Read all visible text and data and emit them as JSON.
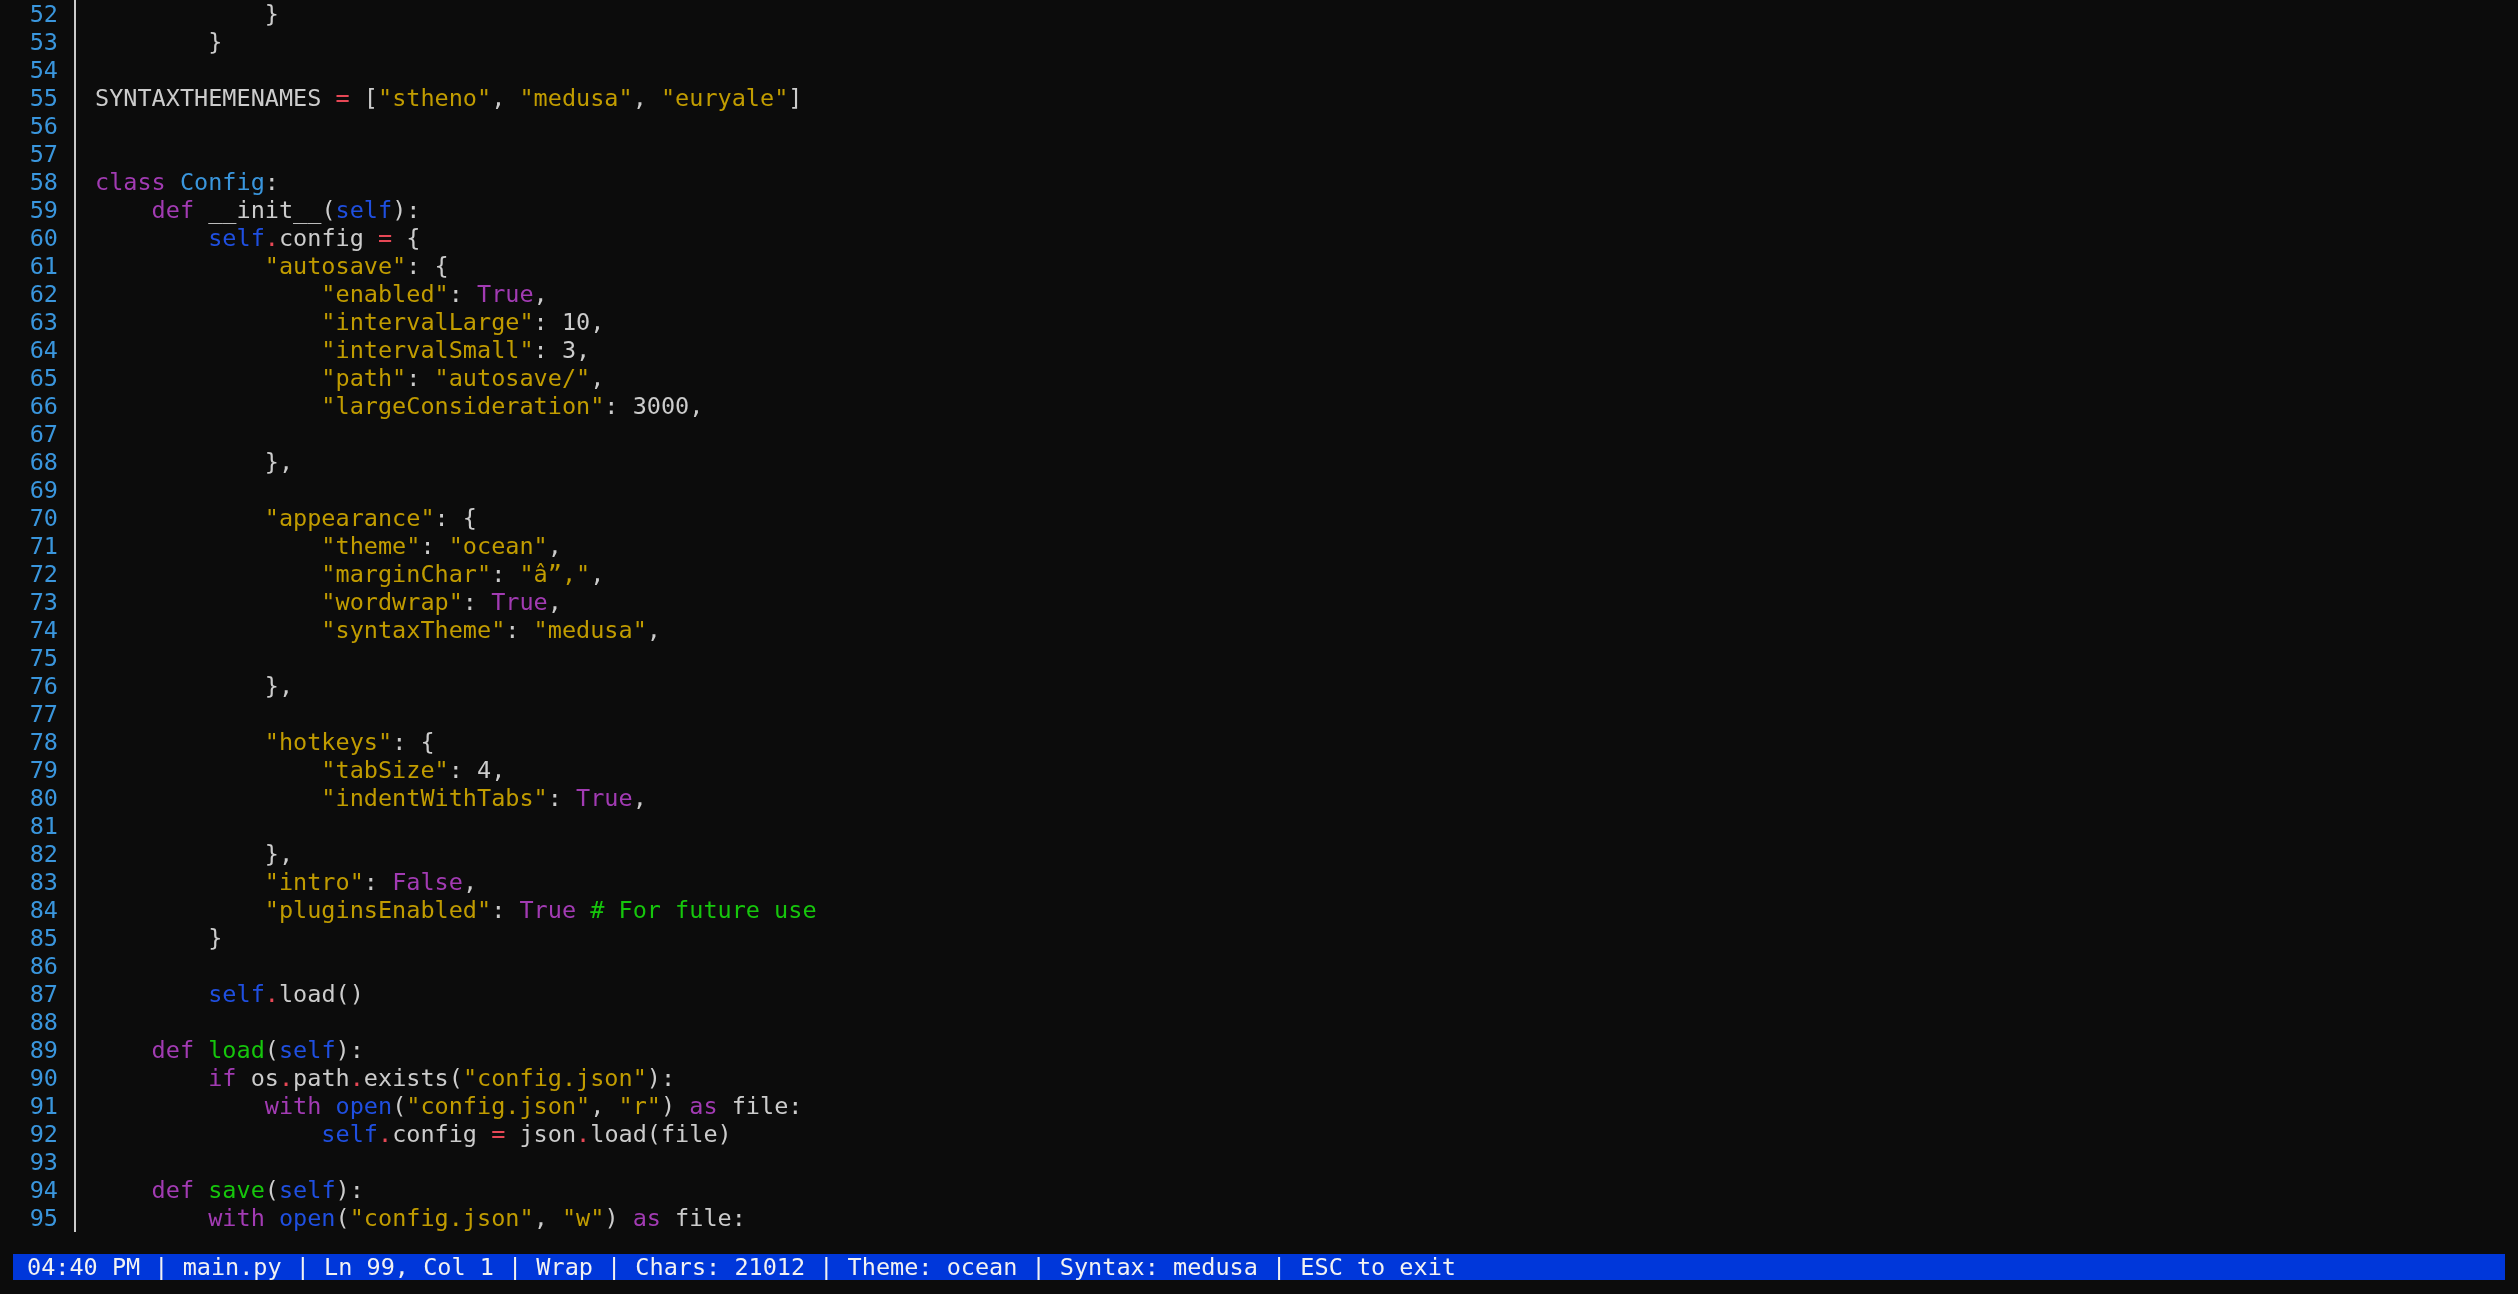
{
  "editor": {
    "lines": [
      {
        "number": "52",
        "tokens": [
          {
            "kind": "plain",
            "text": "            }"
          }
        ]
      },
      {
        "number": "53",
        "tokens": [
          {
            "kind": "plain",
            "text": "        }"
          }
        ]
      },
      {
        "number": "54"
      },
      {
        "number": "55",
        "tokens": [
          {
            "kind": "plain",
            "text": "SYNTAXTHEMENAMES "
          },
          {
            "kind": "operator",
            "text": "="
          },
          {
            "kind": "plain",
            "text": " ["
          },
          {
            "kind": "string",
            "text": "\"stheno\""
          },
          {
            "kind": "plain",
            "text": ", "
          },
          {
            "kind": "string",
            "text": "\"medusa\""
          },
          {
            "kind": "plain",
            "text": ", "
          },
          {
            "kind": "string",
            "text": "\"euryale\""
          },
          {
            "kind": "plain",
            "text": "]"
          }
        ]
      },
      {
        "number": "56"
      },
      {
        "number": "57"
      },
      {
        "number": "58",
        "tokens": [
          {
            "kind": "keyword",
            "text": "class"
          },
          {
            "kind": "classname",
            "text": " Config"
          },
          {
            "kind": "plain",
            "text": ":"
          }
        ]
      },
      {
        "number": "59",
        "tokens": [
          {
            "kind": "keyword",
            "text": "    def"
          },
          {
            "kind": "plain",
            "text": " __init__("
          },
          {
            "kind": "builtin",
            "text": "self"
          },
          {
            "kind": "plain",
            "text": "):"
          }
        ]
      },
      {
        "number": "60",
        "tokens": [
          {
            "kind": "builtin",
            "text": "        self"
          },
          {
            "kind": "operator",
            "text": "."
          },
          {
            "kind": "plain",
            "text": "config "
          },
          {
            "kind": "operator",
            "text": "="
          },
          {
            "kind": "plain",
            "text": " {"
          }
        ]
      },
      {
        "number": "61",
        "tokens": [
          {
            "kind": "string",
            "text": "            \"autosave\""
          },
          {
            "kind": "plain",
            "text": ": {"
          }
        ]
      },
      {
        "number": "62",
        "tokens": [
          {
            "kind": "string",
            "text": "                \"enabled\""
          },
          {
            "kind": "plain",
            "text": ": "
          },
          {
            "kind": "constant",
            "text": "True"
          },
          {
            "kind": "plain",
            "text": ","
          }
        ]
      },
      {
        "number": "63",
        "tokens": [
          {
            "kind": "string",
            "text": "                \"intervalLarge\""
          },
          {
            "kind": "plain",
            "text": ": 10,"
          }
        ]
      },
      {
        "number": "64",
        "tokens": [
          {
            "kind": "string",
            "text": "                \"intervalSmall\""
          },
          {
            "kind": "plain",
            "text": ": 3,"
          }
        ]
      },
      {
        "number": "65",
        "tokens": [
          {
            "kind": "string",
            "text": "                \"path\""
          },
          {
            "kind": "plain",
            "text": ": "
          },
          {
            "kind": "string",
            "text": "\"autosave/\""
          },
          {
            "kind": "plain",
            "text": ","
          }
        ]
      },
      {
        "number": "66",
        "tokens": [
          {
            "kind": "string",
            "text": "                \"largeConsideration\""
          },
          {
            "kind": "plain",
            "text": ": 3000,"
          }
        ]
      },
      {
        "number": "67"
      },
      {
        "number": "68",
        "tokens": [
          {
            "kind": "plain",
            "text": "            },"
          }
        ]
      },
      {
        "number": "69"
      },
      {
        "number": "70",
        "tokens": [
          {
            "kind": "string",
            "text": "            \"appearance\""
          },
          {
            "kind": "plain",
            "text": ": {"
          }
        ]
      },
      {
        "number": "71",
        "tokens": [
          {
            "kind": "string",
            "text": "                \"theme\""
          },
          {
            "kind": "plain",
            "text": ": "
          },
          {
            "kind": "string",
            "text": "\"ocean\""
          },
          {
            "kind": "plain",
            "text": ","
          }
        ]
      },
      {
        "number": "72",
        "tokens": [
          {
            "kind": "string",
            "text": "                \"marginChar\""
          },
          {
            "kind": "plain",
            "text": ": "
          },
          {
            "kind": "string",
            "text": "\"â”,\""
          },
          {
            "kind": "plain",
            "text": ","
          }
        ]
      },
      {
        "number": "73",
        "tokens": [
          {
            "kind": "string",
            "text": "                \"wordwrap\""
          },
          {
            "kind": "plain",
            "text": ": "
          },
          {
            "kind": "constant",
            "text": "True"
          },
          {
            "kind": "plain",
            "text": ","
          }
        ]
      },
      {
        "number": "74",
        "tokens": [
          {
            "kind": "string",
            "text": "                \"syntaxTheme\""
          },
          {
            "kind": "plain",
            "text": ": "
          },
          {
            "kind": "string",
            "text": "\"medusa\""
          },
          {
            "kind": "plain",
            "text": ","
          }
        ]
      },
      {
        "number": "75"
      },
      {
        "number": "76",
        "tokens": [
          {
            "kind": "plain",
            "text": "            },"
          }
        ]
      },
      {
        "number": "77"
      },
      {
        "number": "78",
        "tokens": [
          {
            "kind": "string",
            "text": "            \"hotkeys\""
          },
          {
            "kind": "plain",
            "text": ": {"
          }
        ]
      },
      {
        "number": "79",
        "tokens": [
          {
            "kind": "string",
            "text": "                \"tabSize\""
          },
          {
            "kind": "plain",
            "text": ": 4,"
          }
        ]
      },
      {
        "number": "80",
        "tokens": [
          {
            "kind": "string",
            "text": "                \"indentWithTabs\""
          },
          {
            "kind": "plain",
            "text": ": "
          },
          {
            "kind": "constant",
            "text": "True"
          },
          {
            "kind": "plain",
            "text": ","
          }
        ]
      },
      {
        "number": "81"
      },
      {
        "number": "82",
        "tokens": [
          {
            "kind": "plain",
            "text": "            },"
          }
        ]
      },
      {
        "number": "83",
        "tokens": [
          {
            "kind": "string",
            "text": "            \"intro\""
          },
          {
            "kind": "plain",
            "text": ": "
          },
          {
            "kind": "constant",
            "text": "False"
          },
          {
            "kind": "plain",
            "text": ","
          }
        ]
      },
      {
        "number": "84",
        "tokens": [
          {
            "kind": "string",
            "text": "            \"pluginsEnabled\""
          },
          {
            "kind": "plain",
            "text": ": "
          },
          {
            "kind": "constant",
            "text": "True"
          },
          {
            "kind": "comment",
            "text": " # For future use"
          }
        ]
      },
      {
        "number": "85",
        "tokens": [
          {
            "kind": "plain",
            "text": "        }"
          }
        ]
      },
      {
        "number": "86"
      },
      {
        "number": "87",
        "tokens": [
          {
            "kind": "builtin",
            "text": "        self"
          },
          {
            "kind": "operator",
            "text": "."
          },
          {
            "kind": "plain",
            "text": "load()"
          }
        ]
      },
      {
        "number": "88"
      },
      {
        "number": "89",
        "tokens": [
          {
            "kind": "keyword",
            "text": "    def"
          },
          {
            "kind": "function",
            "text": " load"
          },
          {
            "kind": "plain",
            "text": "("
          },
          {
            "kind": "builtin",
            "text": "self"
          },
          {
            "kind": "plain",
            "text": "):"
          }
        ]
      },
      {
        "number": "90",
        "tokens": [
          {
            "kind": "keyword",
            "text": "        if"
          },
          {
            "kind": "plain",
            "text": " os"
          },
          {
            "kind": "operator",
            "text": "."
          },
          {
            "kind": "plain",
            "text": "path"
          },
          {
            "kind": "operator",
            "text": "."
          },
          {
            "kind": "plain",
            "text": "exists("
          },
          {
            "kind": "string",
            "text": "\"config.json\""
          },
          {
            "kind": "plain",
            "text": "):"
          }
        ]
      },
      {
        "number": "91",
        "tokens": [
          {
            "kind": "keyword",
            "text": "            with"
          },
          {
            "kind": "builtin",
            "text": " open"
          },
          {
            "kind": "plain",
            "text": "("
          },
          {
            "kind": "string",
            "text": "\"config.json\""
          },
          {
            "kind": "plain",
            "text": ", "
          },
          {
            "kind": "string",
            "text": "\"r\""
          },
          {
            "kind": "plain",
            "text": ") "
          },
          {
            "kind": "keyword",
            "text": "as"
          },
          {
            "kind": "plain",
            "text": " file:"
          }
        ]
      },
      {
        "number": "92",
        "tokens": [
          {
            "kind": "builtin",
            "text": "                self"
          },
          {
            "kind": "operator",
            "text": "."
          },
          {
            "kind": "plain",
            "text": "config "
          },
          {
            "kind": "operator",
            "text": "="
          },
          {
            "kind": "plain",
            "text": " json"
          },
          {
            "kind": "operator",
            "text": "."
          },
          {
            "kind": "plain",
            "text": "load(file)"
          }
        ]
      },
      {
        "number": "93"
      },
      {
        "number": "94",
        "tokens": [
          {
            "kind": "keyword",
            "text": "    def"
          },
          {
            "kind": "function",
            "text": " save"
          },
          {
            "kind": "plain",
            "text": "("
          },
          {
            "kind": "builtin",
            "text": "self"
          },
          {
            "kind": "plain",
            "text": "):"
          }
        ]
      },
      {
        "number": "95",
        "tokens": [
          {
            "kind": "keyword",
            "text": "        with"
          },
          {
            "kind": "builtin",
            "text": " open"
          },
          {
            "kind": "plain",
            "text": "("
          },
          {
            "kind": "string",
            "text": "\"config.json\""
          },
          {
            "kind": "plain",
            "text": ", "
          },
          {
            "kind": "string",
            "text": "\"w\""
          },
          {
            "kind": "plain",
            "text": ") "
          },
          {
            "kind": "keyword",
            "text": "as"
          },
          {
            "kind": "plain",
            "text": " file:"
          }
        ]
      }
    ]
  },
  "status_bar": {
    "text": "04:40 PM | main.py | Ln 99, Col 1 | Wrap | Chars: 21012 | Theme: ocean | Syntax: medusa | ESC to exit"
  }
}
